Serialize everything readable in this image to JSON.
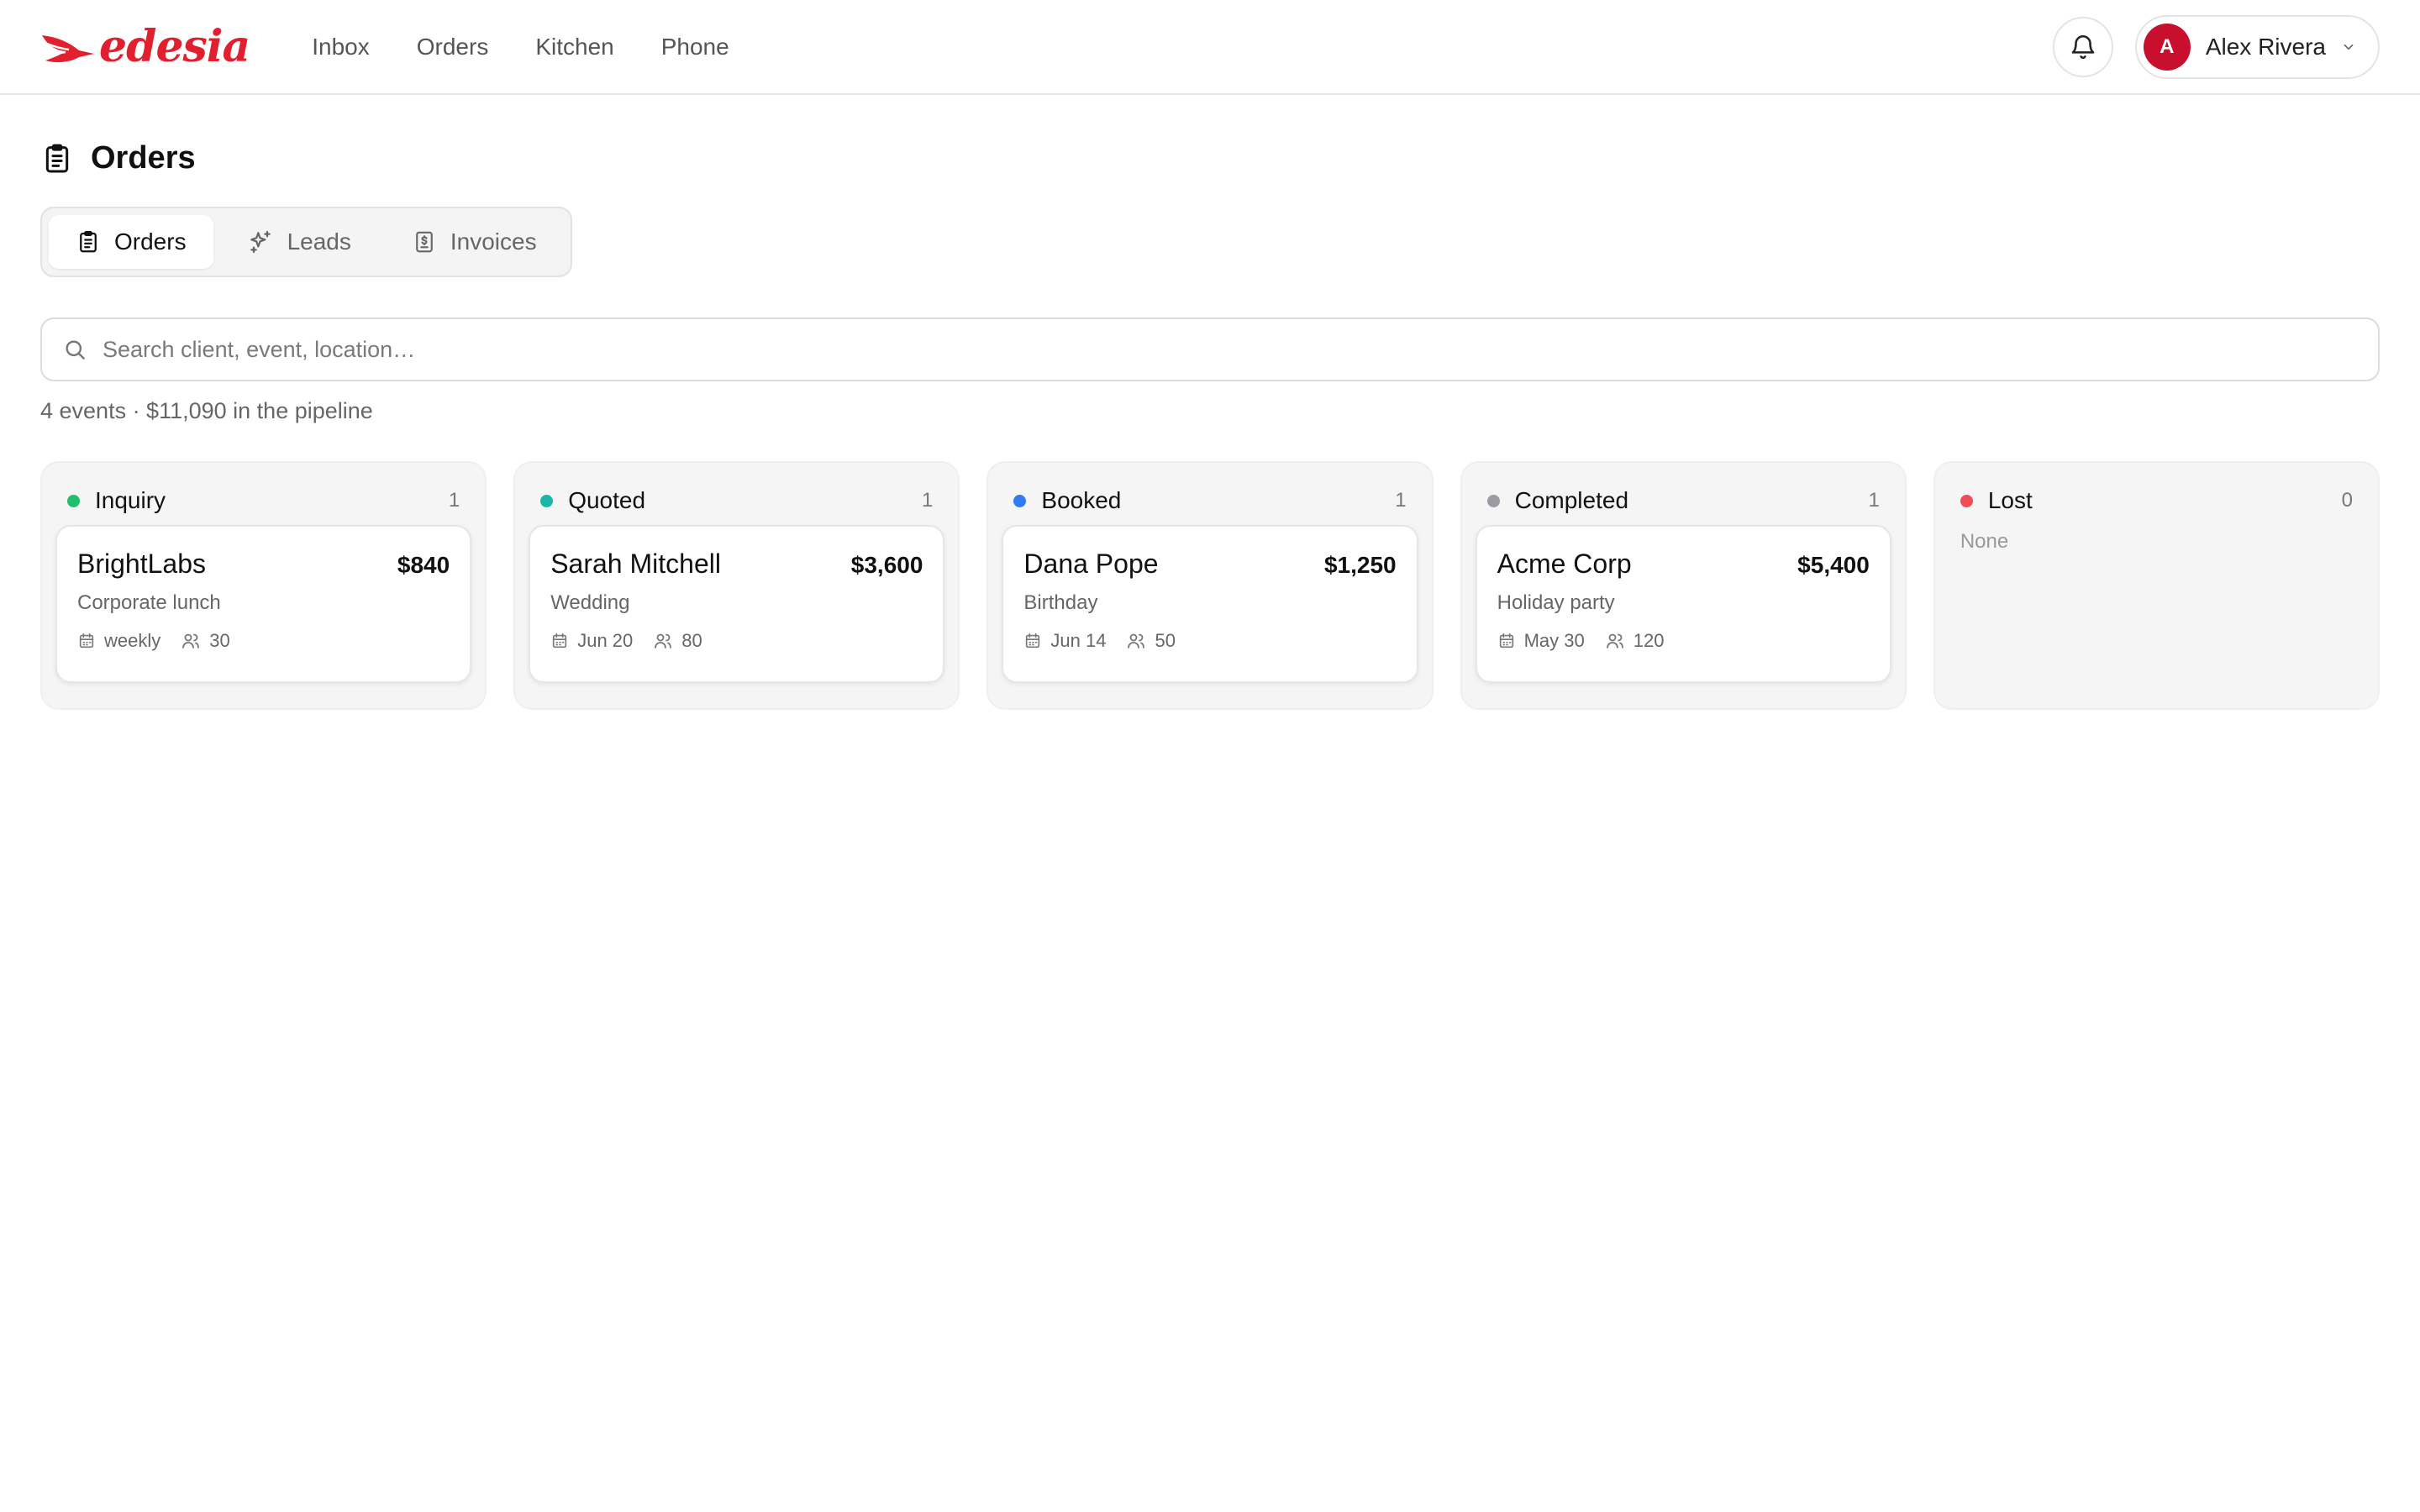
{
  "brand": {
    "name": "edesia",
    "color": "#e0202f"
  },
  "nav": [
    {
      "label": "Inbox"
    },
    {
      "label": "Orders"
    },
    {
      "label": "Kitchen"
    },
    {
      "label": "Phone"
    }
  ],
  "user": {
    "initial": "A",
    "name": "Alex Rivera",
    "avatar_color": "#c8102e"
  },
  "page": {
    "title": "Orders",
    "icon": "clipboard-icon"
  },
  "tabs": [
    {
      "label": "Orders",
      "icon": "clipboard-icon",
      "active": true
    },
    {
      "label": "Leads",
      "icon": "sparkles-icon",
      "active": false
    },
    {
      "label": "Invoices",
      "icon": "invoice-icon",
      "active": false
    }
  ],
  "search": {
    "placeholder": "Search client, event, location…",
    "value": ""
  },
  "summary": "4 events · $11,090 in the pipeline",
  "columns": [
    {
      "title": "Inquiry",
      "count": "1",
      "color": "#1fbf6e",
      "cards": [
        {
          "client": "BrightLabs",
          "amount": "$840",
          "event": "Corporate lunch",
          "date": "weekly",
          "guests": "30"
        }
      ]
    },
    {
      "title": "Quoted",
      "count": "1",
      "color": "#17b8a6",
      "cards": [
        {
          "client": "Sarah Mitchell",
          "amount": "$3,600",
          "event": "Wedding",
          "date": "Jun 20",
          "guests": "80"
        }
      ]
    },
    {
      "title": "Booked",
      "count": "1",
      "color": "#2f7bf5",
      "cards": [
        {
          "client": "Dana Pope",
          "amount": "$1,250",
          "event": "Birthday",
          "date": "Jun 14",
          "guests": "50"
        }
      ]
    },
    {
      "title": "Completed",
      "count": "1",
      "color": "#9a9ba3",
      "cards": [
        {
          "client": "Acme Corp",
          "amount": "$5,400",
          "event": "Holiday party",
          "date": "May 30",
          "guests": "120"
        }
      ]
    },
    {
      "title": "Lost",
      "count": "0",
      "color": "#ef4d56",
      "empty_text": "None",
      "cards": []
    }
  ]
}
